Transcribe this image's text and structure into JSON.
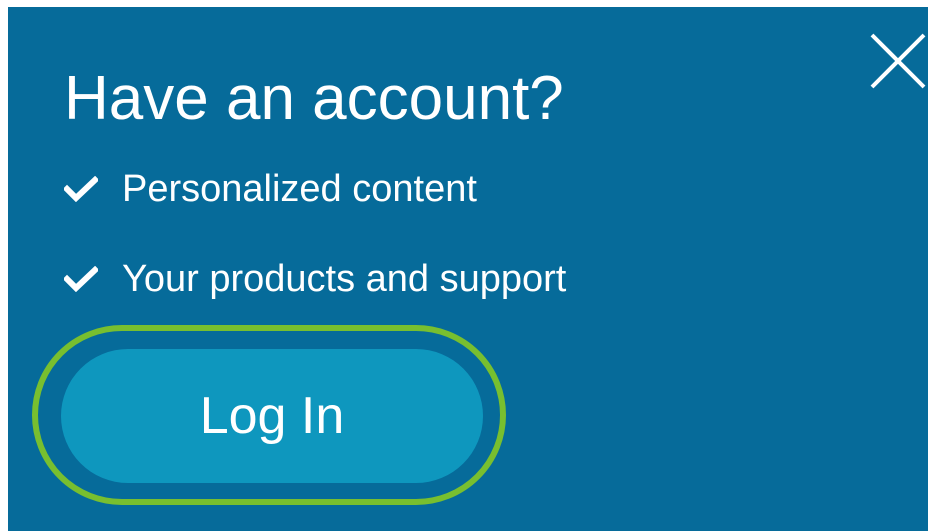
{
  "dialog": {
    "title": "Have an account?",
    "features": [
      {
        "icon": "check-icon",
        "label": "Personalized content"
      },
      {
        "icon": "check-icon",
        "label": "Your products and support"
      }
    ],
    "login_label": "Log In",
    "close_icon": "close-icon"
  },
  "colors": {
    "panel_background": "#066b9a",
    "button_background": "#0e97be",
    "highlight_outline": "#78bf2f",
    "text": "#ffffff"
  }
}
